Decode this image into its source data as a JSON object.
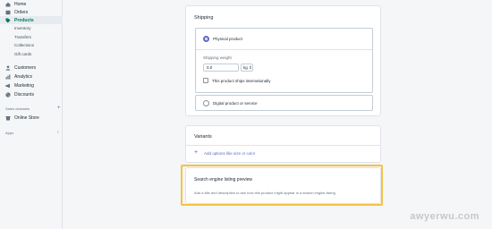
{
  "sidebar": {
    "items": [
      {
        "label": "Home",
        "icon": "home-icon"
      },
      {
        "label": "Orders",
        "icon": "orders-icon"
      },
      {
        "label": "Products",
        "icon": "tag-icon"
      },
      {
        "label": "Customers",
        "icon": "person-icon"
      },
      {
        "label": "Analytics",
        "icon": "bar-chart-icon"
      },
      {
        "label": "Marketing",
        "icon": "megaphone-icon"
      },
      {
        "label": "Discounts",
        "icon": "discount-icon"
      }
    ],
    "products_sub": [
      "Inventory",
      "Transfers",
      "Collections",
      "Gift cards"
    ],
    "sales_channels_heading": "Sales channels",
    "online_store": "Online Store",
    "apps_heading": "Apps"
  },
  "shipping": {
    "title": "Shipping",
    "physical_product": "Physical product",
    "weight_label": "Shipping weight",
    "weight_value": "0.0",
    "weight_unit": "kg ⇕",
    "international_label": "This product ships internationally",
    "digital_product": "Digital product or service"
  },
  "variants": {
    "title": "Variants",
    "add_options": "Add options like size or color"
  },
  "seo": {
    "title": "Search engine listing preview",
    "description": "Add a title and description to see how this product might appear in a search engine listing"
  },
  "watermark": "awyerwu.com",
  "colors": {
    "accent": "#5c6ac4",
    "active": "#007b5c",
    "highlight": "#f5c242"
  }
}
